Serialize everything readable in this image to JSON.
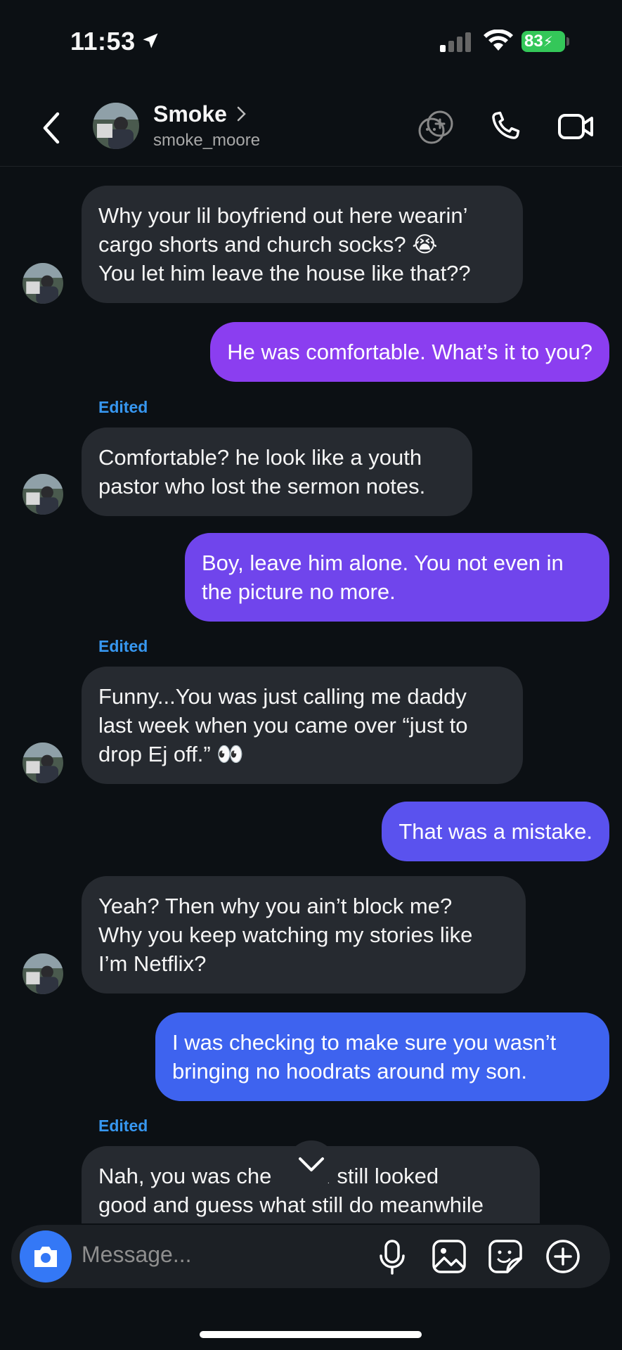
{
  "status_bar": {
    "time": "11:53",
    "battery": "83"
  },
  "header": {
    "name": "Smoke",
    "username": "smoke_moore",
    "icons": [
      "back-chevron-icon",
      "emoji-effects-icon",
      "phone-icon",
      "video-icon"
    ]
  },
  "messages": [
    {
      "dir": "in",
      "lines": [
        "Why your lil boyfriend out here wearin’",
        "cargo shorts and church socks? 😭",
        "You let him leave the house like that??"
      ]
    },
    {
      "dir": "out",
      "lines": [
        "He was comfortable. What’s it to you?"
      ]
    },
    {
      "dir": "edited",
      "text": "Edited"
    },
    {
      "dir": "in",
      "lines": [
        "Comfortable? he look like a youth",
        "pastor who lost the sermon notes."
      ]
    },
    {
      "dir": "out",
      "lines": [
        "Boy, leave him alone. You not even in",
        "the picture no more."
      ]
    },
    {
      "dir": "edited",
      "text": "Edited"
    },
    {
      "dir": "in",
      "lines": [
        "Funny...You was just calling me daddy",
        "last week when you came over “just to",
        "drop Ej off.” 👀"
      ]
    },
    {
      "dir": "out",
      "lines": [
        "That was a mistake."
      ]
    },
    {
      "dir": "in",
      "lines": [
        "Yeah? Then why you ain’t block me?",
        "Why you keep watching my stories like",
        "I’m Netflix?"
      ]
    },
    {
      "dir": "out",
      "lines": [
        "I was checking to make sure you wasn’t",
        "bringing no hoodrats around my son."
      ]
    },
    {
      "dir": "edited",
      "text": "Edited"
    },
    {
      "dir": "in",
      "lines": [
        "Nah, you was che      if I still looked",
        "good and guess what still do meanwhile"
      ]
    }
  ],
  "composer": {
    "placeholder": "Message...",
    "icons": [
      "camera-icon",
      "microphone-icon",
      "gallery-icon",
      "sticker-icon",
      "add-icon"
    ]
  },
  "colors": {
    "bg": "#0c1014",
    "incoming": "#262a30",
    "outgoing_1": "#8b3ef0",
    "outgoing_2": "#7045ec",
    "outgoing_3": "#5a52ee",
    "outgoing_4": "#3e63ef",
    "edited": "#3797f0"
  }
}
